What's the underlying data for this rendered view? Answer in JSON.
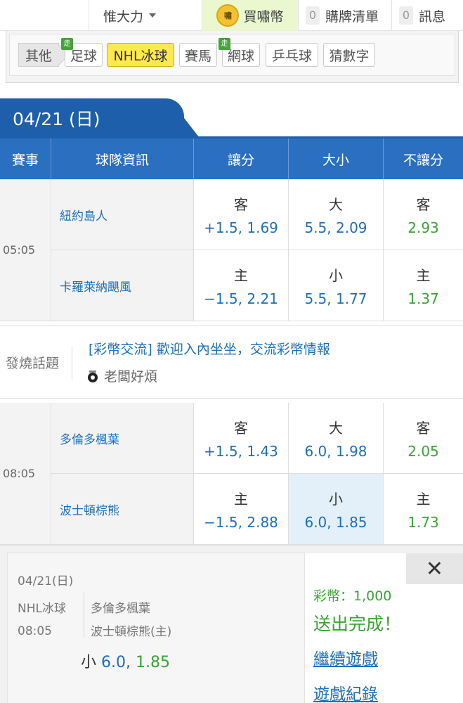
{
  "nav": {
    "user_label": "惟大力",
    "buy_coin_icon_text": "嘯",
    "buy_label": "買嘯幣",
    "cart_count": "0",
    "cart_label": "購牌清單",
    "msg_count": "0",
    "msg_label": "訊息"
  },
  "sports": {
    "other_label": "其他",
    "go_badge": "走",
    "chips": [
      "足球",
      "NHL冰球",
      "賽馬",
      "網球",
      "乒乓球",
      "猜數字"
    ],
    "active": "NHL冰球"
  },
  "date_tab": "04/21 (日)",
  "table": {
    "headers": [
      "賽事",
      "球隊資訊",
      "讓分",
      "大小",
      "不讓分"
    ],
    "matches": [
      {
        "time": "05:05",
        "rows": [
          {
            "team": "紐約島人",
            "hcp_side": "客",
            "hcp_odds": "+1.5, 1.69",
            "ou_side": "大",
            "ou_odds": "5.5, 2.09",
            "ml_side": "客",
            "ml_odds": "2.93"
          },
          {
            "team": "卡羅萊納颶風",
            "hcp_side": "主",
            "hcp_odds": "−1.5, 2.21",
            "ou_side": "小",
            "ou_odds": "5.5, 1.77",
            "ml_side": "主",
            "ml_odds": "1.37"
          }
        ]
      },
      {
        "time": "08:05",
        "rows": [
          {
            "team": "多倫多楓葉",
            "hcp_side": "客",
            "hcp_odds": "+1.5, 1.43",
            "ou_side": "大",
            "ou_odds": "6.0, 1.98",
            "ml_side": "客",
            "ml_odds": "2.05"
          },
          {
            "team": "波士頓棕熊",
            "hcp_side": "主",
            "hcp_odds": "−1.5, 2.88",
            "ou_side": "小",
            "ou_odds": "6.0, 1.85",
            "ml_side": "主",
            "ml_odds": "1.73"
          }
        ]
      }
    ]
  },
  "topic": {
    "label": "發燒話題",
    "title": "[彩幣交流] 歡迎入內坐坐，交流彩幣情報",
    "author": "老闆好煩"
  },
  "bet_popup": {
    "date": "04/21(日)",
    "league": "NHL冰球",
    "time": "08:05",
    "team_away": "多倫多楓葉",
    "team_home": "波士頓棕熊(主)",
    "pick_side": "小",
    "pick_line": "6.0",
    "pick_odds": "1.85",
    "close_glyph": "✕",
    "coin_text": "彩幣：1,000",
    "done_text": "送出完成！",
    "continue_link": "繼續遊戲",
    "history_link": "遊戲紀錄"
  },
  "colors": {
    "primary_blue": "#1d5faa",
    "header_blue": "#2a6fc0",
    "link_blue": "#1d6fbb",
    "green": "#3aa335",
    "active_chip": "#ffe94d",
    "highlight_cell": "#e3f0fa"
  }
}
